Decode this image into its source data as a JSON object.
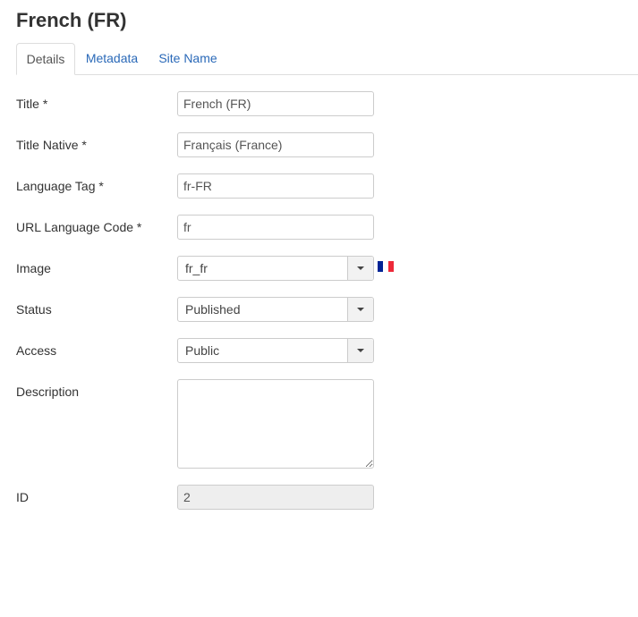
{
  "page": {
    "title": "French (FR)"
  },
  "tabs": [
    {
      "label": "Details",
      "active": true
    },
    {
      "label": "Metadata",
      "active": false
    },
    {
      "label": "Site Name",
      "active": false
    }
  ],
  "form": {
    "title": {
      "label": "Title *",
      "value": "French (FR)"
    },
    "title_native": {
      "label": "Title Native *",
      "value": "Français (France)"
    },
    "language_tag": {
      "label": "Language Tag *",
      "value": "fr-FR"
    },
    "url_code": {
      "label": "URL Language Code *",
      "value": "fr"
    },
    "image": {
      "label": "Image",
      "value": "fr_fr",
      "flag_icon": "flag-fr-icon"
    },
    "status": {
      "label": "Status",
      "value": "Published"
    },
    "access": {
      "label": "Access",
      "value": "Public"
    },
    "description": {
      "label": "Description",
      "value": ""
    },
    "id": {
      "label": "ID",
      "value": "2"
    }
  },
  "colors": {
    "link": "#2a69b8",
    "flag_blue": "#002395",
    "flag_white": "#ffffff",
    "flag_red": "#ed2939"
  }
}
